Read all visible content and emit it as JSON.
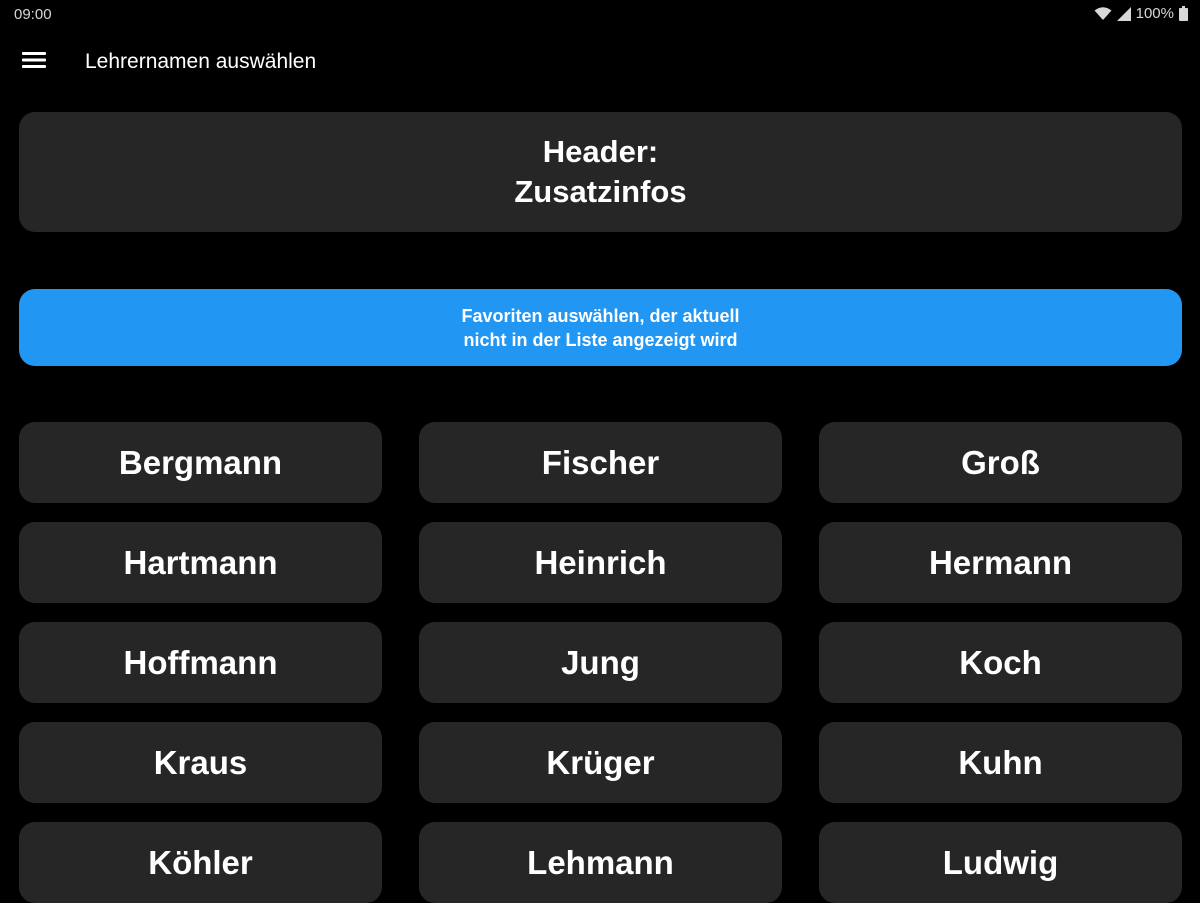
{
  "status_bar": {
    "time": "09:00",
    "battery": "100%",
    "icons": [
      "wifi-icon",
      "signal-icon",
      "battery-icon"
    ]
  },
  "app_bar": {
    "menu_icon": "hamburger-menu-icon",
    "title": "Lehrernamen auswählen"
  },
  "header_card": {
    "line1": "Header:",
    "line2": "Zusatzinfos"
  },
  "favorite_button": {
    "line1": "Favoriten auswählen, der aktuell",
    "line2": "nicht in der Liste angezeigt wird",
    "color": "#2196f3"
  },
  "teachers": [
    "Bergmann",
    "Fischer",
    "Groß",
    "Hartmann",
    "Heinrich",
    "Hermann",
    "Hoffmann",
    "Jung",
    "Koch",
    "Kraus",
    "Krüger",
    "Kuhn",
    "Köhler",
    "Lehmann",
    "Ludwig"
  ],
  "colors": {
    "background": "#000000",
    "card": "#262626",
    "accent": "#2196f3",
    "text": "#ffffff"
  }
}
